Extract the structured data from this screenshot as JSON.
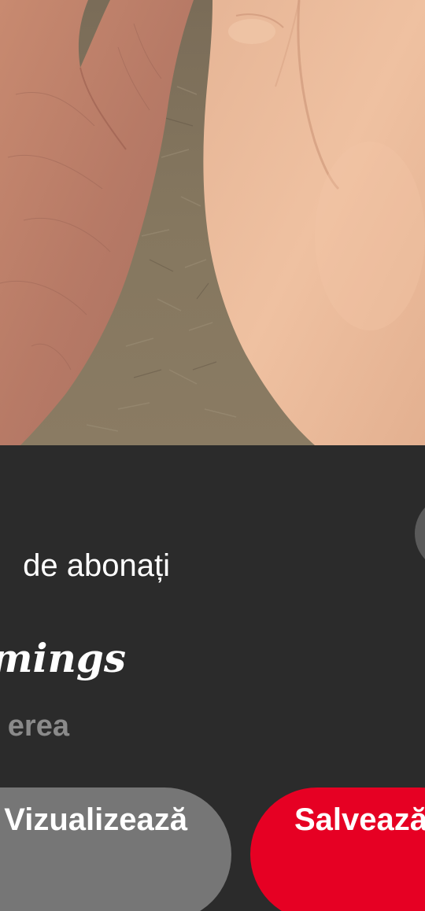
{
  "pin": {
    "image_alt": "Două mâini, una în vârstă și una tânără, pe un fundal de pământ"
  },
  "creator": {
    "followers_text": "de abonați",
    "board_title": "omings"
  },
  "description": {
    "text": "erea"
  },
  "actions": {
    "view_label": "Vizualizează",
    "save_label": "Salvează"
  },
  "colors": {
    "background": "#2b2b2b",
    "save_button": "#e60023",
    "view_button": "#767676"
  }
}
